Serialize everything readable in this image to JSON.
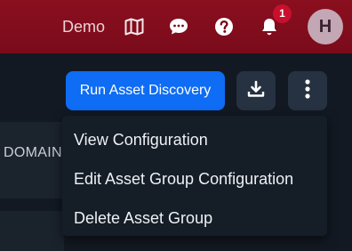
{
  "topbar": {
    "demo_label": "Demo",
    "icons": [
      "map-icon",
      "chat-icon",
      "help-icon",
      "bell-icon"
    ],
    "notification_count": "1",
    "avatar_initial": "H"
  },
  "sidebar": {
    "domain_label": "DOMAIN"
  },
  "toolbar": {
    "run_label": "Run Asset Discovery",
    "download_icon": "download-icon",
    "more_icon": "more-vertical-icon"
  },
  "menu": {
    "items": [
      {
        "label": "View Configuration"
      },
      {
        "label": "Edit Asset Group Configuration"
      },
      {
        "label": "Delete Asset Group"
      }
    ]
  },
  "colors": {
    "topbar": "#7a0b1b",
    "primary": "#0e6cf5",
    "background": "#121922",
    "badge": "#c8102e"
  }
}
